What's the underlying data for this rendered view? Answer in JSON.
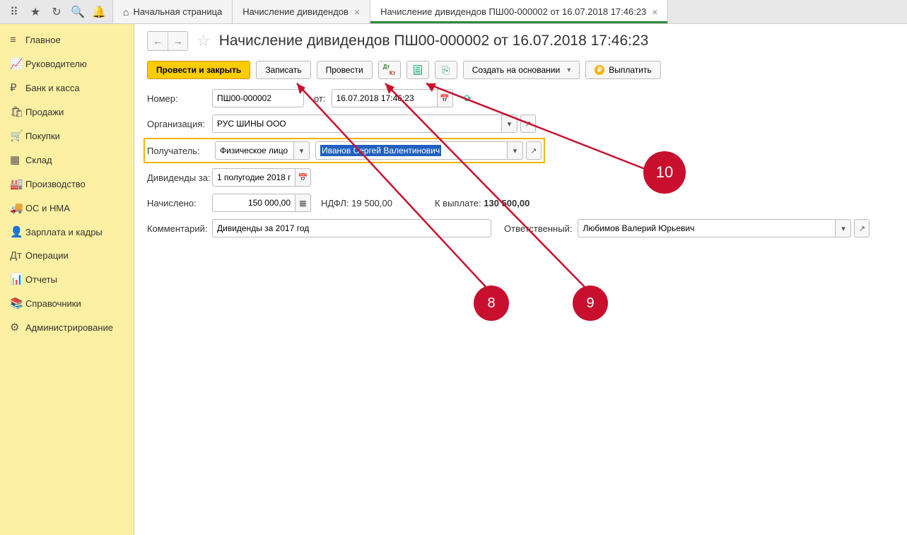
{
  "tabs": {
    "home": "Начальная страница",
    "t1": "Начисление дивидендов",
    "t2": "Начисление дивидендов ПШ00-000002 от 16.07.2018 17:46:23"
  },
  "sidebar": [
    {
      "ico": "≡",
      "label": "Главное"
    },
    {
      "ico": "📈",
      "label": "Руководителю"
    },
    {
      "ico": "₽",
      "label": "Банк и касса"
    },
    {
      "ico": "🛍",
      "label": "Продажи"
    },
    {
      "ico": "🛒",
      "label": "Покупки"
    },
    {
      "ico": "▦",
      "label": "Склад"
    },
    {
      "ico": "🏭",
      "label": "Производство"
    },
    {
      "ico": "🚚",
      "label": "ОС и НМА"
    },
    {
      "ico": "👤",
      "label": "Зарплата и кадры"
    },
    {
      "ico": "Дт",
      "label": "Операции"
    },
    {
      "ico": "📊",
      "label": "Отчеты"
    },
    {
      "ico": "📚",
      "label": "Справочники"
    },
    {
      "ico": "⚙",
      "label": "Администрирование"
    }
  ],
  "title": "Начисление дивидендов ПШ00-000002 от 16.07.2018 17:46:23",
  "toolbar": {
    "post_close": "Провести и закрыть",
    "save": "Записать",
    "post": "Провести",
    "create_based": "Создать на основании",
    "pay": "Выплатить"
  },
  "form": {
    "number_lbl": "Номер:",
    "number": "ПШ00-000002",
    "from_lbl": "от:",
    "date": "16.07.2018 17:46:23",
    "org_lbl": "Организация:",
    "org": "РУС ШИНЫ ООО",
    "recip_lbl": "Получатель:",
    "recip_type": "Физическое лицо",
    "recip_name": "Иванов Сергей Валентинович",
    "period_lbl": "Дивиденды за:",
    "period": "1 полугодие 2018 г",
    "accrued_lbl": "Начислено:",
    "accrued": "150 000,00",
    "ndfl_lbl": "НДФЛ:",
    "ndfl": "19 500,00",
    "topay_lbl": "К выплате:",
    "topay": "130 500,00",
    "comment_lbl": "Комментарий:",
    "comment": "Дивиденды за 2017 год",
    "resp_lbl": "Ответственный:",
    "resp": "Любимов Валерий Юрьевич"
  },
  "markers": {
    "m8": "8",
    "m9": "9",
    "m10": "10"
  }
}
